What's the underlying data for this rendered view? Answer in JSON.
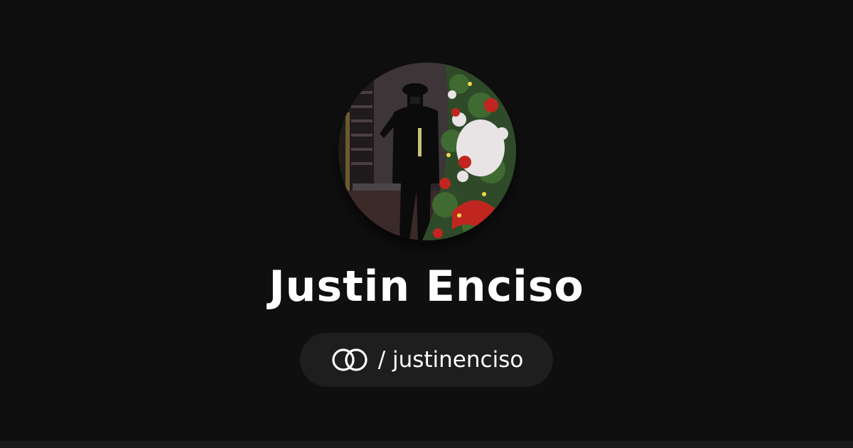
{
  "profile": {
    "name": "Justin Enciso",
    "handle": "/ justinenciso"
  },
  "icons": {
    "avatar": "profile-photo-avatar",
    "logo": "interlocking-rings-logo-icon"
  },
  "colors": {
    "background": "#0f0f0f",
    "pill_background": "#1e1e1e",
    "text": "#ffffff"
  }
}
